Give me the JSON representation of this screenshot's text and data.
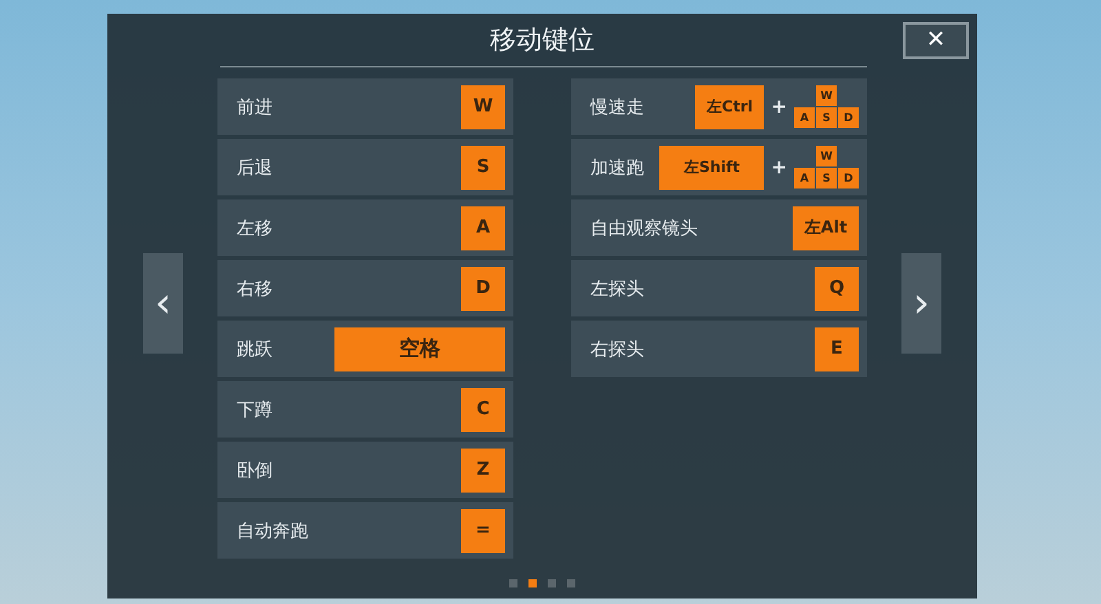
{
  "title": "移动键位",
  "close": "✕",
  "left_arrow": "‹",
  "right_arrow": "›",
  "left_bindings": [
    {
      "label": "前进",
      "kind": "single",
      "key": "W"
    },
    {
      "label": "后退",
      "kind": "single",
      "key": "S"
    },
    {
      "label": "左移",
      "kind": "single",
      "key": "A"
    },
    {
      "label": "右移",
      "kind": "single",
      "key": "D"
    },
    {
      "label": "跳跃",
      "kind": "wide",
      "key": "空格"
    },
    {
      "label": "下蹲",
      "kind": "single",
      "key": "C"
    },
    {
      "label": "卧倒",
      "kind": "single",
      "key": "Z"
    },
    {
      "label": "自动奔跑",
      "kind": "single",
      "key": "="
    }
  ],
  "right_bindings": [
    {
      "label": "慢速走",
      "kind": "combo",
      "key": "左Ctrl",
      "plus": "+",
      "wasd": [
        "W",
        "A",
        "S",
        "D"
      ]
    },
    {
      "label": "加速跑",
      "kind": "combo",
      "key": "左Shift",
      "plus": "+",
      "wasd": [
        "W",
        "A",
        "S",
        "D"
      ]
    },
    {
      "label": "自由观察镜头",
      "kind": "medium",
      "key": "左Alt"
    },
    {
      "label": "左探头",
      "kind": "single",
      "key": "Q"
    },
    {
      "label": "右探头",
      "kind": "single",
      "key": "E"
    }
  ],
  "pages": [
    {
      "selected": false
    },
    {
      "selected": true
    },
    {
      "selected": false
    },
    {
      "selected": false
    }
  ]
}
